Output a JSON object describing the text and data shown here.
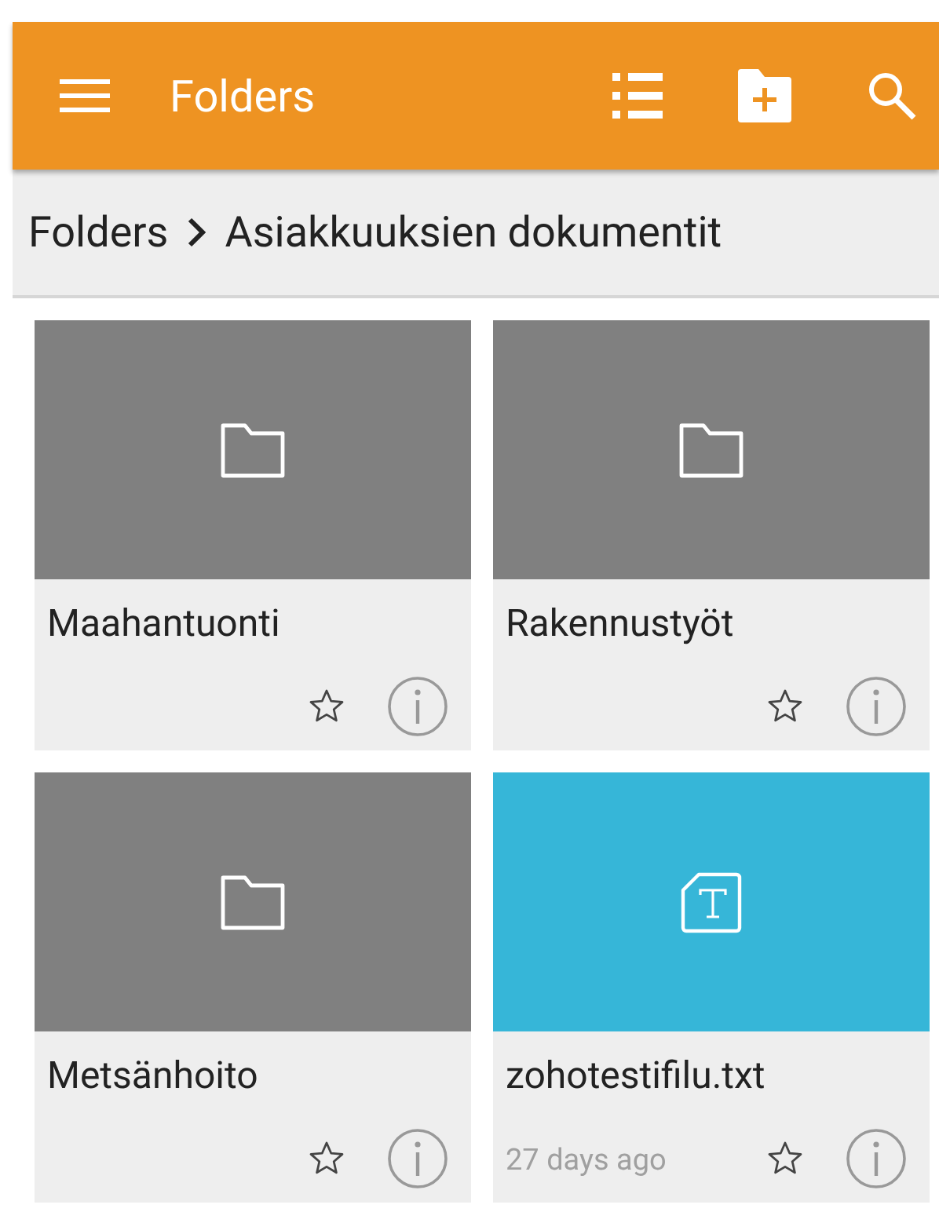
{
  "app_bar": {
    "title": "Folders"
  },
  "breadcrumb": [
    {
      "label": "Folders"
    },
    {
      "label": "Asiakkuuksien dokumentit"
    }
  ],
  "items": [
    {
      "kind": "folder",
      "name": "Maahantuonti",
      "starred": false
    },
    {
      "kind": "folder",
      "name": "Rakennustyöt",
      "starred": false
    },
    {
      "kind": "folder",
      "name": "Metsänhoito",
      "starred": false
    },
    {
      "kind": "file",
      "name": "zohotestifilu.txt",
      "modified": "27 days ago",
      "starred": false
    }
  ]
}
